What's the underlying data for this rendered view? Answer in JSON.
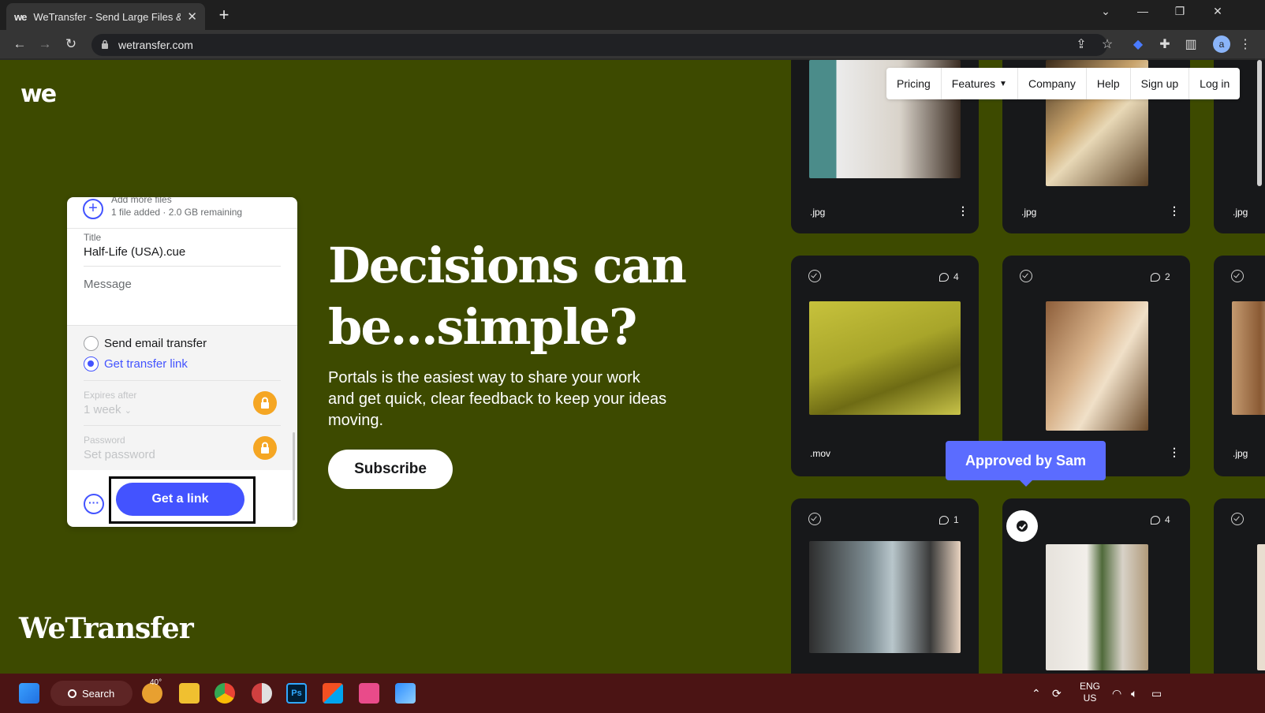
{
  "browser": {
    "tab_title": "WeTransfer - Send Large Files &",
    "favicon": "we",
    "url": "wetransfer.com",
    "profile_initial": "a"
  },
  "nav": {
    "items": [
      "Pricing",
      "Features",
      "Company",
      "Help",
      "Sign up",
      "Log in"
    ]
  },
  "brand": {
    "logo": "we",
    "wordmark": "WeTransfer"
  },
  "transfer": {
    "add_more": "Add more files",
    "files_info": "1 file added · 2.0 GB remaining",
    "title_label": "Title",
    "title_value": "Half-Life (USA).cue",
    "message_placeholder": "Message",
    "option_email": "Send email transfer",
    "option_link": "Get transfer link",
    "expires_label": "Expires after",
    "expires_value": "1 week",
    "password_label": "Password",
    "password_placeholder": "Set password",
    "button_label": "Get a link"
  },
  "hero": {
    "headline_line1": "Decisions can",
    "headline_line2": "be...simple?",
    "subtext": "Portals is the easiest way to share your work and get quick, clear feedback to keep your ideas moving.",
    "cta": "Subscribe"
  },
  "gallery": {
    "cards": [
      {
        "ext": ".jpg"
      },
      {
        "ext": ".jpg"
      },
      {
        "ext": ".jpg"
      },
      {
        "ext": ".mov",
        "comments": "4"
      },
      {
        "comments": "2"
      },
      {
        "ext": ".jpg"
      },
      {
        "comments": "1"
      },
      {
        "comments": "4"
      }
    ],
    "tooltip": "Approved by Sam"
  },
  "taskbar": {
    "search_label": "Search",
    "weather_temp": "40°",
    "lang_line1": "ENG",
    "lang_line2": "US"
  },
  "colors": {
    "page_bg": "#3d4a00",
    "accent": "#4353ff",
    "card_bg": "#17181a",
    "taskbar_bg": "#4b1414",
    "lock_badge": "#f5a623"
  }
}
